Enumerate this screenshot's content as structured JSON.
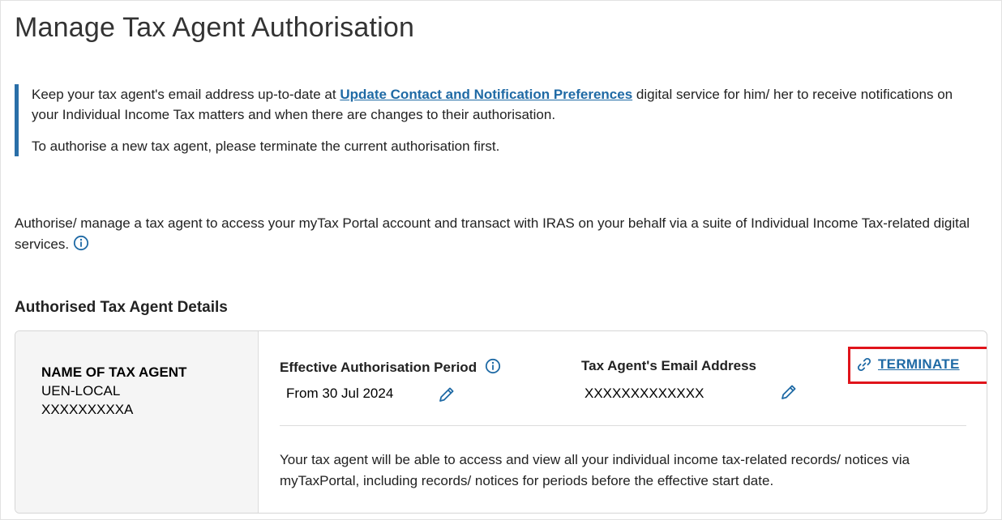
{
  "page": {
    "title": "Manage Tax Agent Authorisation"
  },
  "notice": {
    "text_before_link": "Keep your tax agent's email address up-to-date at ",
    "link_label": "Update Contact and Notification Preferences",
    "text_after_link": " digital service for him/ her to receive notifications on your Individual Income Tax matters and when there are changes to their authorisation.",
    "second_line": "To authorise a new tax agent, please terminate the current authorisation first."
  },
  "intro": {
    "text": "Authorise/ manage a tax agent to access your myTax Portal account and transact with IRAS on your behalf via a suite of Individual Income Tax-related digital services."
  },
  "section": {
    "title": "Authorised Tax Agent Details"
  },
  "agent": {
    "name": "NAME OF TAX AGENT",
    "uen_type": "UEN-LOCAL",
    "uen_number": "XXXXXXXXXA"
  },
  "authorisation": {
    "period_label": "Effective Authorisation Period",
    "period_value": "From 30 Jul 2024",
    "email_label": "Tax Agent's Email Address",
    "email_value": "XXXXXXXXXXXXX",
    "terminate_label": "TERMINATE",
    "note": "Your tax agent will be able to access and view all your individual income tax-related records/ notices via myTaxPortal, including records/ notices for periods before the effective start date."
  },
  "colors": {
    "accent_blue": "#1f6aa5",
    "highlight_red": "#e0141b"
  },
  "icons": [
    "info-icon",
    "pencil-icon",
    "link-icon"
  ]
}
